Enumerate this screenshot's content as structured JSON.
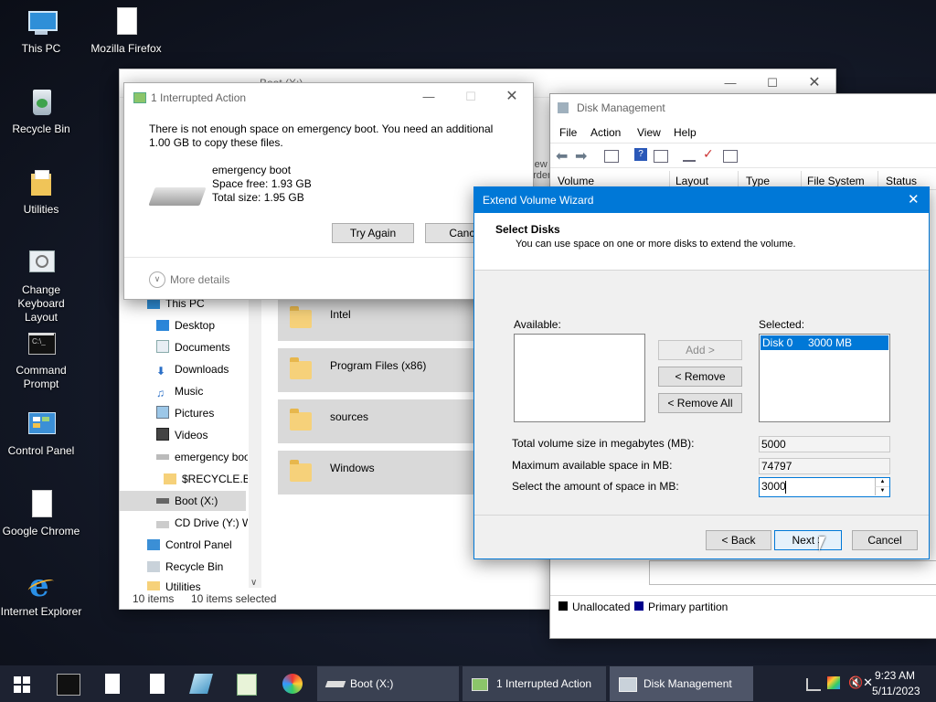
{
  "desktop": {
    "icons": [
      {
        "label": "This PC"
      },
      {
        "label": "Mozilla Firefox"
      },
      {
        "label": "Recycle Bin"
      },
      {
        "label": "Utilities"
      },
      {
        "label": "Change Keyboard Layout"
      },
      {
        "label": "Command Prompt"
      },
      {
        "label": "Control Panel"
      },
      {
        "label": "Google Chrome"
      },
      {
        "label": "Internet Explorer"
      }
    ]
  },
  "explorer": {
    "title": "Boot (X:)",
    "view_peek": "View",
    "order_peek": "order",
    "nav": [
      {
        "label": "This PC"
      },
      {
        "label": "Desktop"
      },
      {
        "label": "Documents"
      },
      {
        "label": "Downloads"
      },
      {
        "label": "Music"
      },
      {
        "label": "Pictures"
      },
      {
        "label": "Videos"
      },
      {
        "label": "emergency boot"
      },
      {
        "label": "$RECYCLE.BIN"
      },
      {
        "label": "Boot (X:)"
      },
      {
        "label": "CD Drive (Y:) W"
      },
      {
        "label": "Control Panel"
      },
      {
        "label": "Recycle Bin"
      },
      {
        "label": "Utilities"
      }
    ],
    "files": [
      {
        "name": "Intel"
      },
      {
        "name": "Program Files (x86)"
      },
      {
        "name": "sources"
      },
      {
        "name": "Windows"
      }
    ],
    "status_items": "10 items",
    "status_selected": "10 items selected"
  },
  "interrupted": {
    "title": "1 Interrupted Action",
    "message": "There is not enough space on emergency boot. You need an additional 1.00 GB to copy these files.",
    "drive_name": "emergency boot",
    "space_free": "Space free: 1.93 GB",
    "total_size": "Total size: 1.95 GB",
    "try_again": "Try Again",
    "cancel": "Cancel",
    "more_details": "More details"
  },
  "diskmgmt": {
    "title": "Disk Management",
    "menu": [
      "File",
      "Action",
      "View",
      "Help"
    ],
    "columns": [
      "Volume",
      "Layout",
      "Type",
      "File System",
      "Status"
    ],
    "legend_unallocated": "Unallocated",
    "legend_primary": "Primary partition",
    "colors": {
      "unallocated": "#000000",
      "primary": "#00008b"
    }
  },
  "wizard": {
    "title": "Extend Volume Wizard",
    "heading": "Select Disks",
    "subheading": "You can use space on one or more disks to extend the volume.",
    "available_label": "Available:",
    "selected_label": "Selected:",
    "selected_item_disk": "Disk 0",
    "selected_item_size": "3000 MB",
    "add_button": "Add >",
    "remove_button": "< Remove",
    "remove_all_button": "< Remove All",
    "total_label": "Total volume size in megabytes (MB):",
    "total_value": "5000",
    "max_label": "Maximum available space in MB:",
    "max_value": "74797",
    "amount_label": "Select the amount of space in MB:",
    "amount_value": "3000",
    "back_button": "< Back",
    "next_button": "Next >",
    "cancel_button": "Cancel",
    "accent": "#0078d7"
  },
  "taskbar": {
    "items": [
      {
        "label": "Boot (X:)"
      },
      {
        "label": "1 Interrupted Action"
      },
      {
        "label": "Disk Management"
      }
    ],
    "time": "9:23 AM",
    "date": "5/11/2023"
  }
}
